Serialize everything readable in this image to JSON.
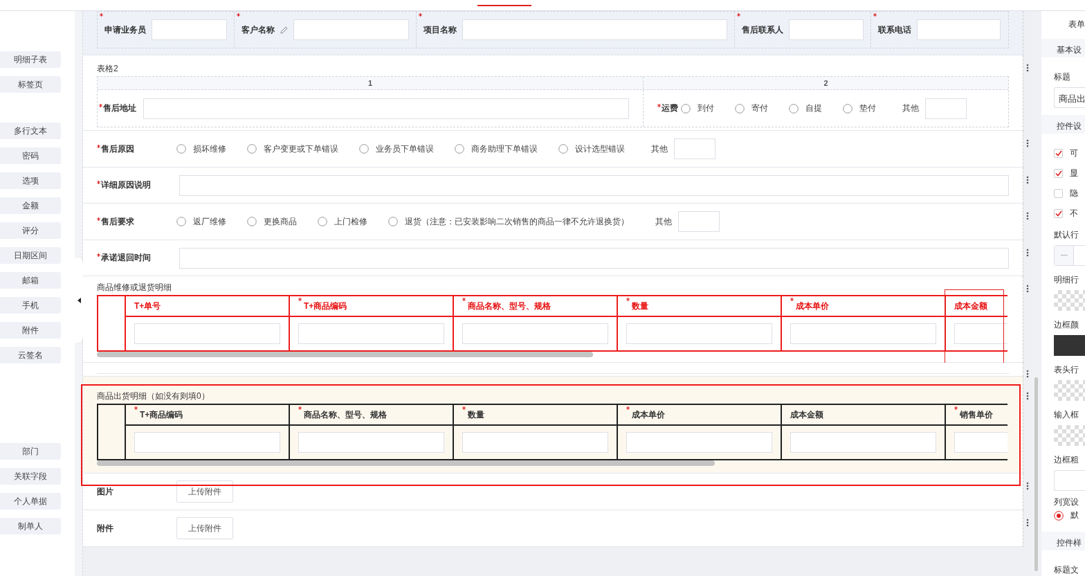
{
  "sidebar": {
    "groups": [
      {
        "items": [
          "明细子表",
          "标签页"
        ]
      },
      {
        "items": [
          "多行文本",
          "密码",
          "选项",
          "金额",
          "评分",
          "日期区间",
          "邮箱",
          "手机",
          "附件",
          "云签名"
        ]
      },
      {
        "items": [
          "部门",
          "关联字段",
          "个人单据",
          "制单人"
        ]
      }
    ]
  },
  "header_fields": [
    {
      "label": "申请业务员",
      "required": true,
      "edit_icon": false
    },
    {
      "label": "客户名称",
      "required": true,
      "edit_icon": true
    },
    {
      "label": "项目名称",
      "required": true,
      "edit_icon": false
    },
    {
      "label": "售后联系人",
      "required": true,
      "edit_icon": false
    },
    {
      "label": "联系电话",
      "required": true,
      "edit_icon": false
    }
  ],
  "sections": [
    {
      "kind": "grid",
      "selected": false,
      "title": "表格2",
      "columns": [
        "1",
        "2"
      ],
      "cells": [
        {
          "kind": "text",
          "label": "售后地址",
          "required": true
        },
        {
          "kind": "radio",
          "label": "运费",
          "required": true,
          "options": [
            {
              "label": "到付",
              "selected": false
            },
            {
              "label": "寄付",
              "selected": false
            },
            {
              "label": "自提",
              "selected": false
            },
            {
              "label": "垫付",
              "selected": false
            }
          ],
          "other_label": "其他"
        }
      ]
    },
    {
      "kind": "radio",
      "selected": false,
      "label": "售后原因",
      "required": true,
      "options": [
        {
          "label": "损坏维修",
          "selected": false
        },
        {
          "label": "客户变更或下单错误",
          "selected": false
        },
        {
          "label": "业务员下单错误",
          "selected": false
        },
        {
          "label": "商务助理下单错误",
          "selected": false
        },
        {
          "label": "设计选型错误",
          "selected": false
        }
      ],
      "other_label": "其他"
    },
    {
      "kind": "text",
      "selected": false,
      "label": "详细原因说明",
      "required": true
    },
    {
      "kind": "radio",
      "selected": false,
      "label": "售后要求",
      "required": true,
      "options": [
        {
          "label": "返厂维修",
          "selected": false
        },
        {
          "label": "更换商品",
          "selected": false
        },
        {
          "label": "上门检修",
          "selected": false
        },
        {
          "label": "退货（注意：已安装影响二次销售的商品一律不允许退换货）",
          "selected": false
        }
      ],
      "other_label": "其他"
    },
    {
      "kind": "text",
      "selected": false,
      "label": "承诺退回时间",
      "required": true
    },
    {
      "kind": "table",
      "selected": false,
      "invalid": true,
      "title": "商品维修或退货明细",
      "columns": [
        {
          "label": "T+单号",
          "required": false,
          "selected": false
        },
        {
          "label": "T+商品编码",
          "required": true,
          "selected": false
        },
        {
          "label": "商品名称、型号、规格",
          "required": true,
          "selected": false
        },
        {
          "label": "数量",
          "required": true,
          "selected": false
        },
        {
          "label": "成本单价",
          "required": true,
          "selected": false
        },
        {
          "label": "成本金额",
          "required": false,
          "selected": true
        }
      ]
    },
    {
      "kind": "divider",
      "selected": false
    },
    {
      "kind": "table",
      "selected": true,
      "invalid": false,
      "title": "商品出货明细（如没有则填0）",
      "columns": [
        {
          "label": "T+商品编码",
          "required": true,
          "selected": false
        },
        {
          "label": "商品名称、型号、规格",
          "required": true,
          "selected": false
        },
        {
          "label": "数量",
          "required": true,
          "selected": false
        },
        {
          "label": "成本单价",
          "required": true,
          "selected": false
        },
        {
          "label": "成本金额",
          "required": false,
          "selected": false
        },
        {
          "label": "销售单价",
          "required": true,
          "selected": false
        }
      ]
    },
    {
      "kind": "upload",
      "selected": false,
      "label": "图片",
      "button": "上传附件"
    },
    {
      "kind": "upload",
      "selected": false,
      "label": "附件",
      "button": "上传附件"
    }
  ],
  "properties_panel": {
    "tab": "表单",
    "groups": [
      {
        "title": "基本设",
        "fields": [
          {
            "kind": "text",
            "label": "标题",
            "value": "商品出"
          }
        ]
      },
      {
        "title": "控件设",
        "fields": [
          {
            "kind": "checkbox",
            "label": "可",
            "checked": true
          },
          {
            "kind": "checkbox",
            "label": "显",
            "checked": true
          },
          {
            "kind": "checkbox",
            "label": "隐",
            "checked": false
          },
          {
            "kind": "checkbox",
            "label": "不",
            "checked": true
          },
          {
            "kind": "stepper",
            "label": "默认行"
          },
          {
            "kind": "transparent_swatch",
            "label": "明细行"
          },
          {
            "kind": "color_swatch",
            "label": "边框颜",
            "color": "#333333"
          },
          {
            "kind": "transparent_swatch",
            "label": "表头行"
          },
          {
            "kind": "transparent_swatch",
            "label": "输入框"
          },
          {
            "kind": "input",
            "label": "边框粗"
          },
          {
            "kind": "radio",
            "label": "列宽设",
            "option": "默",
            "selected": true
          }
        ]
      },
      {
        "title": "控件样",
        "fields": [
          {
            "kind": "label",
            "label": "标题文"
          }
        ]
      }
    ]
  }
}
